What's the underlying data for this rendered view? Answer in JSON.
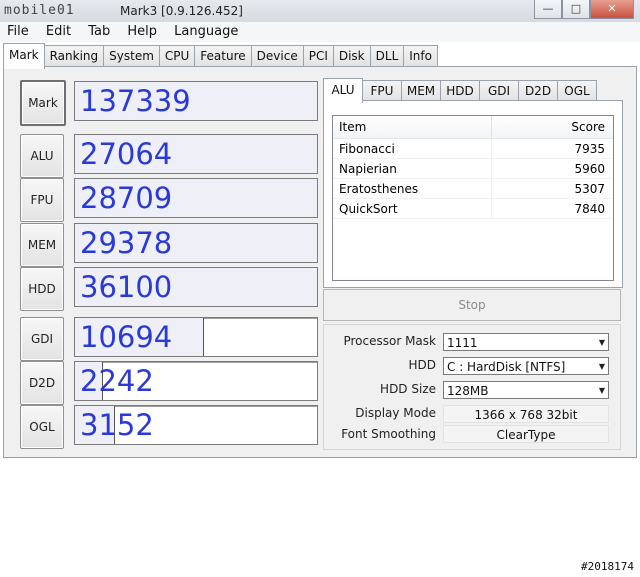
{
  "window": {
    "logo_text": "mobile01",
    "title": "Mark3 [0.9.126.452]",
    "minimize": "—",
    "maximize": "□",
    "close": "✕"
  },
  "menu": [
    "File",
    "Edit",
    "Tab",
    "Help",
    "Language"
  ],
  "tabs": [
    "Mark",
    "Ranking",
    "System",
    "CPU",
    "Feature",
    "Device",
    "PCI",
    "Disk",
    "DLL",
    "Info"
  ],
  "scores": {
    "mark": {
      "label": "Mark",
      "value": "137339"
    },
    "alu": {
      "label": "ALU",
      "value": "27064"
    },
    "fpu": {
      "label": "FPU",
      "value": "28709"
    },
    "mem": {
      "label": "MEM",
      "value": "29378"
    },
    "hdd": {
      "label": "HDD",
      "value": "36100"
    },
    "gdi": {
      "label": "GDI",
      "value": "10694",
      "fill_fraction": 0.53
    },
    "d2d": {
      "label": "D2D",
      "value": "2242",
      "fill_fraction": 0.11
    },
    "ogl": {
      "label": "OGL",
      "value": "3152",
      "fill_fraction": 0.16
    }
  },
  "subtabs": [
    "ALU",
    "FPU",
    "MEM",
    "HDD",
    "GDI",
    "D2D",
    "OGL"
  ],
  "list": {
    "col_item": "Item",
    "col_score": "Score",
    "rows": [
      {
        "item": "Fibonacci",
        "score": "7935"
      },
      {
        "item": "Napierian",
        "score": "5960"
      },
      {
        "item": "Eratosthenes",
        "score": "5307"
      },
      {
        "item": "QuickSort",
        "score": "7840"
      }
    ]
  },
  "stop_label": "Stop",
  "settings": {
    "processor_mask": {
      "label": "Processor Mask",
      "value": "1111"
    },
    "hdd": {
      "label": "HDD",
      "value": "C : HardDisk [NTFS]"
    },
    "hdd_size": {
      "label": "HDD Size",
      "value": "128MB"
    },
    "display_mode": {
      "label": "Display Mode",
      "value": "1366 x 768 32bit"
    },
    "font_smoothing": {
      "label": "Font Smoothing",
      "value": "ClearType"
    }
  },
  "watermark": "#2018174",
  "colors": {
    "score_text": "#2a3ad6",
    "score_fill": "#efeff7"
  }
}
